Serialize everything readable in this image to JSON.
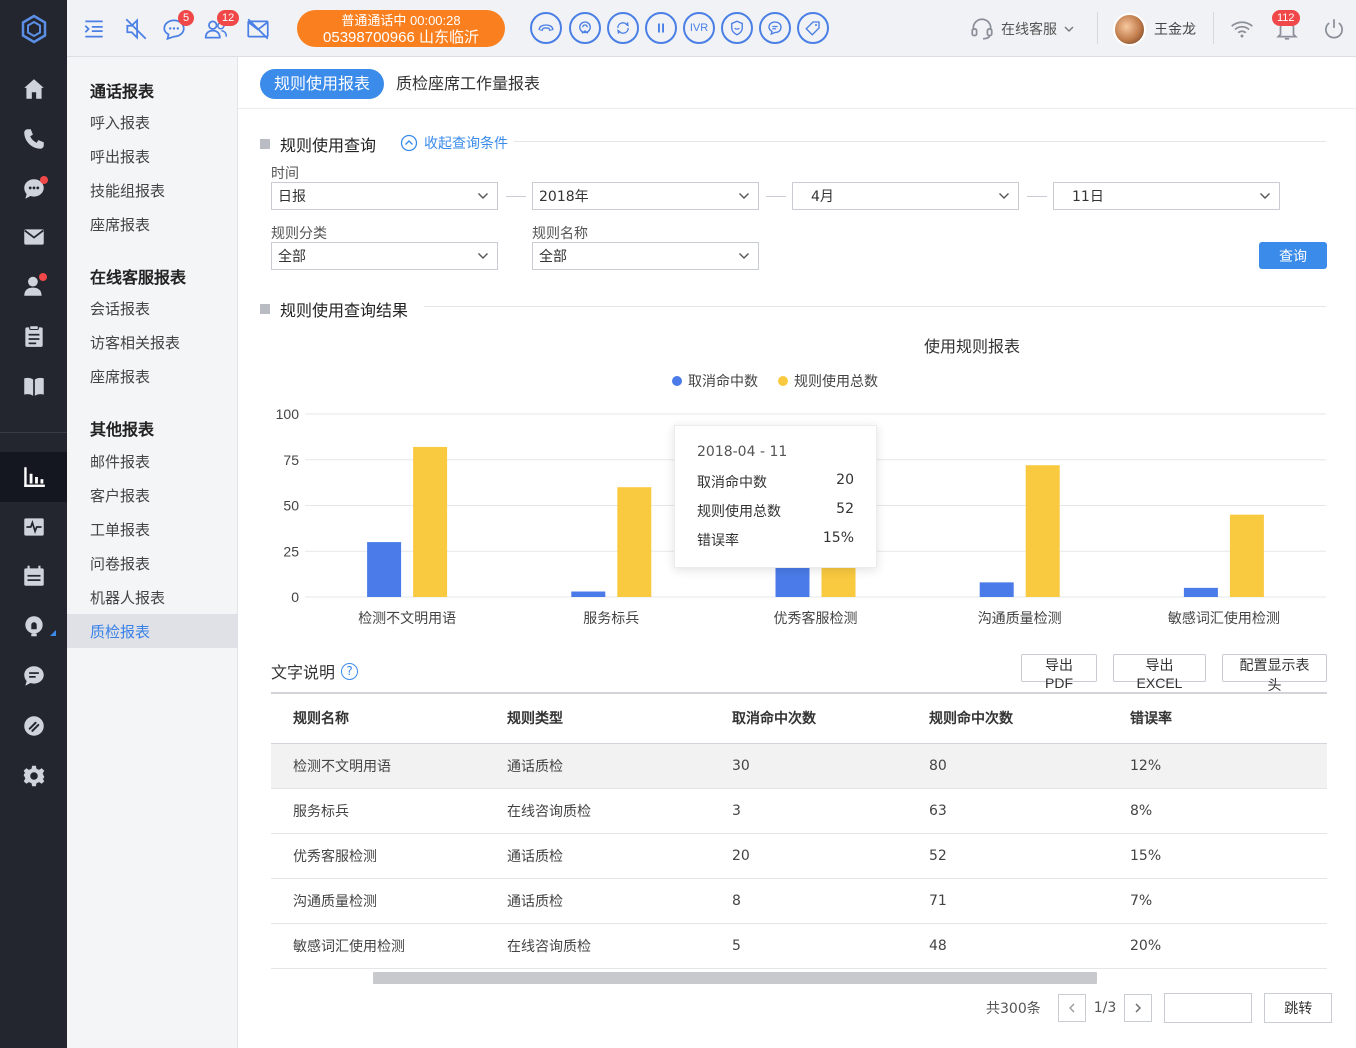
{
  "topbar": {
    "badges": {
      "chat": "5",
      "contacts": "12",
      "notifications": "112"
    },
    "call_status": {
      "line1": "普通通话中 00:00:28",
      "line2": "05398700966 山东临沂"
    },
    "ivr_label": "IVR",
    "service_label": "在线客服",
    "user_name": "王金龙"
  },
  "subnav": {
    "groups": [
      {
        "title": "通话报表",
        "items": [
          "呼入报表",
          "呼出报表",
          "技能组报表",
          "座席报表"
        ]
      },
      {
        "title": "在线客服报表",
        "items": [
          "会话报表",
          "访客相关报表",
          "座席报表"
        ]
      },
      {
        "title": "其他报表",
        "items": [
          "邮件报表",
          "客户报表",
          "工单报表",
          "问卷报表",
          "机器人报表",
          "质检报表"
        ]
      }
    ],
    "active": "质检报表"
  },
  "tabs": [
    "规则使用报表",
    "质检座席工作量报表"
  ],
  "query": {
    "section_title": "规则使用查询",
    "collapse_label": "收起查询条件",
    "time_label": "时间",
    "time_type": "日报",
    "year": "2018年",
    "month": "4月",
    "day": "11日",
    "category_label": "规则分类",
    "category_value": "全部",
    "rule_name_label": "规则名称",
    "rule_name_value": "全部",
    "submit_label": "查询"
  },
  "result_title": "规则使用查询结果",
  "colors": {
    "accent": "#3b8bea",
    "series1": "#4a7be8",
    "series2": "#f9c940",
    "call_status": "#f97f1f",
    "badge": "#f04848"
  },
  "chart_data": {
    "type": "bar",
    "title": "使用规则报表",
    "categories": [
      "检测不文明用语",
      "服务标兵",
      "优秀客服检测",
      "沟通质量检测",
      "敏感词汇使用检测"
    ],
    "series": [
      {
        "name": "取消命中数",
        "values": [
          30,
          3,
          20,
          8,
          5
        ]
      },
      {
        "name": "规则使用总数",
        "values": [
          82,
          60,
          52,
          72,
          45
        ]
      }
    ],
    "yticks": [
      0,
      25,
      50,
      75,
      100
    ],
    "ylim": [
      0,
      100
    ],
    "legend": "top-center",
    "grid": true,
    "tooltip": {
      "date": "2018-04 - 11",
      "rows": [
        {
          "label": "取消命中数",
          "value": "20"
        },
        {
          "label": "规则使用总数",
          "value": "52"
        },
        {
          "label": "错误率",
          "value": "15%"
        }
      ]
    }
  },
  "description": {
    "label": "文字说明",
    "help": "?",
    "buttons": {
      "pdf": "导出PDF",
      "excel": "导出EXCEL",
      "columns": "配置显示表头"
    }
  },
  "table": {
    "headers": [
      "规则名称",
      "规则类型",
      "取消命中次数",
      "规则命中次数",
      "错误率"
    ],
    "rows": [
      [
        "检测不文明用语",
        "通话质检",
        "30",
        "80",
        "12%"
      ],
      [
        "服务标兵",
        "在线咨询质检",
        "3",
        "63",
        "8%"
      ],
      [
        "优秀客服检测",
        "通话质检",
        "20",
        "52",
        "15%"
      ],
      [
        "沟通质量检测",
        "通话质检",
        "8",
        "71",
        "7%"
      ],
      [
        "敏感词汇使用检测",
        "在线咨询质检",
        "5",
        "48",
        "20%"
      ]
    ]
  },
  "pager": {
    "total": "共300条",
    "page": "1/3",
    "jump_label": "跳转"
  }
}
